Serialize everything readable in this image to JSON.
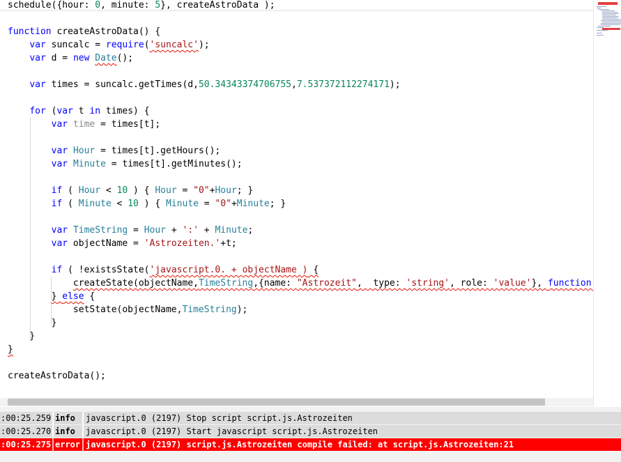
{
  "editor": {
    "code_lines": [
      [
        {
          "t": "schedule({hour: ",
          "k": "plain"
        },
        {
          "t": "0",
          "k": "num"
        },
        {
          "t": ", minute: ",
          "k": "plain"
        },
        {
          "t": "5",
          "k": "num"
        },
        {
          "t": "}, createAstroData );",
          "k": "plain"
        }
      ],
      [],
      [
        {
          "t": "function",
          "k": "kw"
        },
        {
          "t": " createAstroData() {",
          "k": "plain"
        }
      ],
      [
        {
          "t": "    ",
          "k": "plain"
        },
        {
          "t": "var",
          "k": "kw"
        },
        {
          "t": " suncalc = ",
          "k": "plain"
        },
        {
          "t": "require",
          "k": "kw"
        },
        {
          "t": "(",
          "k": "plain"
        },
        {
          "t": "'suncalc'",
          "k": "str",
          "sq": true
        },
        {
          "t": ");",
          "k": "plain"
        }
      ],
      [
        {
          "t": "    ",
          "k": "plain"
        },
        {
          "t": "var",
          "k": "kw"
        },
        {
          "t": " d = ",
          "k": "plain"
        },
        {
          "t": "new",
          "k": "kw"
        },
        {
          "t": " ",
          "k": "plain"
        },
        {
          "t": "Date",
          "k": "var",
          "sq": true
        },
        {
          "t": "();",
          "k": "plain"
        }
      ],
      [],
      [
        {
          "t": "    ",
          "k": "plain"
        },
        {
          "t": "var",
          "k": "kw"
        },
        {
          "t": " times = suncalc.getTimes(d,",
          "k": "plain"
        },
        {
          "t": "50.34343374706755",
          "k": "num"
        },
        {
          "t": ",",
          "k": "plain"
        },
        {
          "t": "7.537372112274171",
          "k": "num"
        },
        {
          "t": ");",
          "k": "plain"
        }
      ],
      [],
      [
        {
          "t": "    ",
          "k": "plain"
        },
        {
          "t": "for",
          "k": "kw"
        },
        {
          "t": " (",
          "k": "plain"
        },
        {
          "t": "var",
          "k": "kw"
        },
        {
          "t": " t ",
          "k": "plain"
        },
        {
          "t": "in",
          "k": "kw"
        },
        {
          "t": " times) {",
          "k": "plain"
        }
      ],
      [
        {
          "t": "        ",
          "k": "plain"
        },
        {
          "t": "var",
          "k": "kw"
        },
        {
          "t": " ",
          "k": "plain"
        },
        {
          "t": "time",
          "k": "dim"
        },
        {
          "t": " = times[t];",
          "k": "plain"
        }
      ],
      [],
      [
        {
          "t": "        ",
          "k": "plain"
        },
        {
          "t": "var",
          "k": "kw"
        },
        {
          "t": " ",
          "k": "plain"
        },
        {
          "t": "Hour",
          "k": "var"
        },
        {
          "t": " = times[t].getHours();",
          "k": "plain"
        }
      ],
      [
        {
          "t": "        ",
          "k": "plain"
        },
        {
          "t": "var",
          "k": "kw"
        },
        {
          "t": " ",
          "k": "plain"
        },
        {
          "t": "Minute",
          "k": "var"
        },
        {
          "t": " = times[t].getMinutes();",
          "k": "plain"
        }
      ],
      [],
      [
        {
          "t": "        ",
          "k": "plain"
        },
        {
          "t": "if",
          "k": "kw"
        },
        {
          "t": " ( ",
          "k": "plain"
        },
        {
          "t": "Hour",
          "k": "var"
        },
        {
          "t": " < ",
          "k": "plain"
        },
        {
          "t": "10",
          "k": "num"
        },
        {
          "t": " ) { ",
          "k": "plain"
        },
        {
          "t": "Hour",
          "k": "var"
        },
        {
          "t": " = ",
          "k": "plain"
        },
        {
          "t": "\"0\"",
          "k": "str"
        },
        {
          "t": "+",
          "k": "plain"
        },
        {
          "t": "Hour",
          "k": "var"
        },
        {
          "t": "; }",
          "k": "plain"
        }
      ],
      [
        {
          "t": "        ",
          "k": "plain"
        },
        {
          "t": "if",
          "k": "kw"
        },
        {
          "t": " ( ",
          "k": "plain"
        },
        {
          "t": "Minute",
          "k": "var"
        },
        {
          "t": " < ",
          "k": "plain"
        },
        {
          "t": "10",
          "k": "num"
        },
        {
          "t": " ) { ",
          "k": "plain"
        },
        {
          "t": "Minute",
          "k": "var"
        },
        {
          "t": " = ",
          "k": "plain"
        },
        {
          "t": "\"0\"",
          "k": "str"
        },
        {
          "t": "+",
          "k": "plain"
        },
        {
          "t": "Minute",
          "k": "var"
        },
        {
          "t": "; }",
          "k": "plain"
        }
      ],
      [],
      [
        {
          "t": "        ",
          "k": "plain"
        },
        {
          "t": "var",
          "k": "kw"
        },
        {
          "t": " ",
          "k": "plain"
        },
        {
          "t": "TimeString",
          "k": "var"
        },
        {
          "t": " = ",
          "k": "plain"
        },
        {
          "t": "Hour",
          "k": "var"
        },
        {
          "t": " + ",
          "k": "plain"
        },
        {
          "t": "':'",
          "k": "str"
        },
        {
          "t": " + ",
          "k": "plain"
        },
        {
          "t": "Minute",
          "k": "var"
        },
        {
          "t": ";",
          "k": "plain"
        }
      ],
      [
        {
          "t": "        ",
          "k": "plain"
        },
        {
          "t": "var",
          "k": "kw"
        },
        {
          "t": " objectName = ",
          "k": "plain"
        },
        {
          "t": "'Astrozeiten.'",
          "k": "str"
        },
        {
          "t": "+t;",
          "k": "plain"
        }
      ],
      [],
      [
        {
          "t": "        ",
          "k": "plain"
        },
        {
          "t": "if",
          "k": "kw"
        },
        {
          "t": " ( !existsState(",
          "k": "plain"
        },
        {
          "t": "'javascript.0. + objectName )",
          "k": "str",
          "sq": true
        },
        {
          "t": " {",
          "k": "plain",
          "sq": true
        }
      ],
      [
        {
          "t": "            ",
          "k": "plain"
        },
        {
          "t": "createState(objectName,",
          "k": "plain",
          "sq": true
        },
        {
          "t": "TimeString",
          "k": "var",
          "sq": true
        },
        {
          "t": ",{name: ",
          "k": "plain",
          "sq": true
        },
        {
          "t": "\"Astrozeit\"",
          "k": "str",
          "sq": true
        },
        {
          "t": ",  type: ",
          "k": "plain",
          "sq": true
        },
        {
          "t": "'string'",
          "k": "str",
          "sq": true
        },
        {
          "t": ", role: ",
          "k": "plain",
          "sq": true
        },
        {
          "t": "'value'",
          "k": "str",
          "sq": true
        },
        {
          "t": "}, ",
          "k": "plain",
          "sq": true
        },
        {
          "t": "function",
          "k": "kw",
          "sq": true
        },
        {
          "t": " (",
          "k": "plain",
          "sq": true
        }
      ],
      [
        {
          "t": "        ",
          "k": "plain"
        },
        {
          "t": "} ",
          "k": "plain",
          "sq": true
        },
        {
          "t": "else",
          "k": "kw",
          "sq": true
        },
        {
          "t": " {",
          "k": "plain"
        }
      ],
      [
        {
          "t": "            setState(objectName,",
          "k": "plain"
        },
        {
          "t": "TimeString",
          "k": "var"
        },
        {
          "t": ");",
          "k": "plain"
        }
      ],
      [
        {
          "t": "        }",
          "k": "plain"
        }
      ],
      [
        {
          "t": "    }",
          "k": "plain"
        }
      ],
      [
        {
          "t": "}",
          "k": "plain",
          "sq": true
        }
      ],
      [],
      [
        {
          "t": "createAstroData();",
          "k": "plain"
        }
      ]
    ]
  },
  "log": {
    "rows": [
      {
        "time": ":00:25.259",
        "level": "info",
        "message": "javascript.0 (2197) Stop script script.js.Astrozeiten"
      },
      {
        "time": ":00:25.270",
        "level": "info",
        "message": "javascript.0 (2197) Start javascript script.js.Astrozeiten"
      },
      {
        "time": ":00:25.275",
        "level": "error",
        "message": "javascript.0 (2197) script.js.Astrozeiten compile failed: at script.js.Astrozeiten:21"
      }
    ]
  }
}
